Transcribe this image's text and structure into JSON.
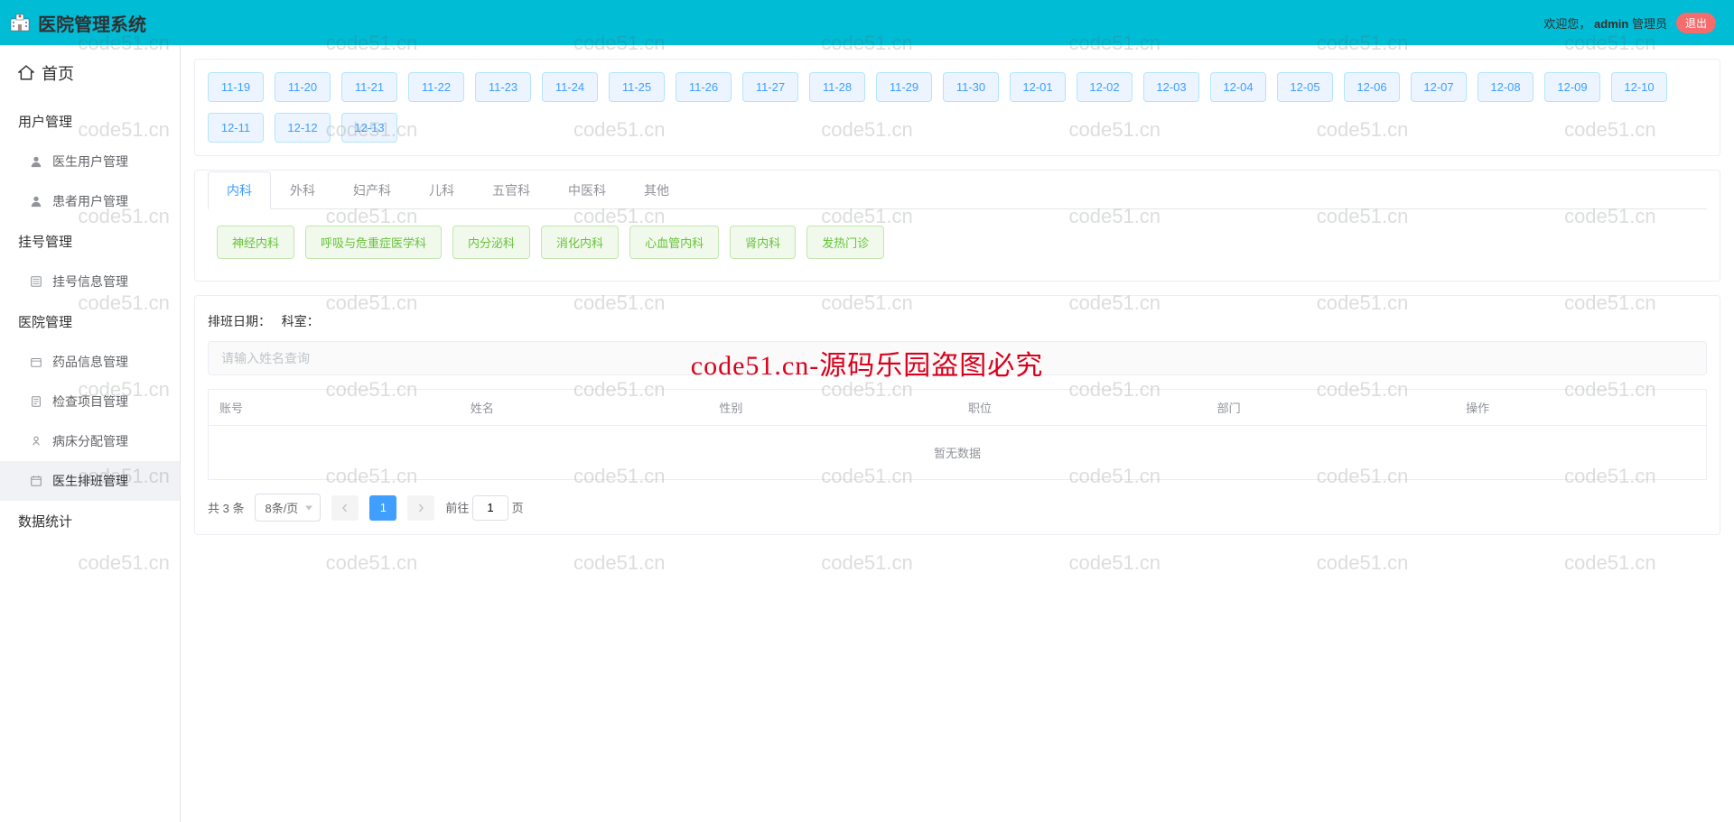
{
  "header": {
    "title": "医院管理系统",
    "welcome_prefix": "欢迎您，",
    "username": "admin",
    "role": "管理员",
    "logout": "退出"
  },
  "sidebar": {
    "home": "首页",
    "sections": [
      {
        "label": "用户管理",
        "items": [
          {
            "key": "doctor-user",
            "icon": "user-icon",
            "label": "医生用户管理"
          },
          {
            "key": "patient-user",
            "icon": "user-icon",
            "label": "患者用户管理"
          }
        ]
      },
      {
        "label": "挂号管理",
        "items": [
          {
            "key": "register-info",
            "icon": "list-icon",
            "label": "挂号信息管理"
          }
        ]
      },
      {
        "label": "医院管理",
        "items": [
          {
            "key": "drug-info",
            "icon": "box-icon",
            "label": "药品信息管理"
          },
          {
            "key": "check-item",
            "icon": "doc-icon",
            "label": "检查项目管理"
          },
          {
            "key": "bed-alloc",
            "icon": "bed-icon",
            "label": "病床分配管理"
          },
          {
            "key": "doctor-schedule",
            "icon": "calendar-icon",
            "label": "医生排班管理",
            "active": true
          }
        ]
      },
      {
        "label": "数据统计",
        "items": []
      }
    ]
  },
  "dates": [
    "11-19",
    "11-20",
    "11-21",
    "11-22",
    "11-23",
    "11-24",
    "11-25",
    "11-26",
    "11-27",
    "11-28",
    "11-29",
    "11-30",
    "12-01",
    "12-02",
    "12-03",
    "12-04",
    "12-05",
    "12-06",
    "12-07",
    "12-08",
    "12-09",
    "12-10",
    "12-11",
    "12-12",
    "12-13"
  ],
  "dept_tabs": [
    "内科",
    "外科",
    "妇产科",
    "儿科",
    "五官科",
    "中医科",
    "其他"
  ],
  "dept_tabs_active": 0,
  "sub_depts": [
    "神经内科",
    "呼吸与危重症医学科",
    "内分泌科",
    "消化内科",
    "心血管内科",
    "肾内科",
    "发热门诊"
  ],
  "filter": {
    "label_date": "排班日期：",
    "label_dept": "科室：",
    "search_placeholder": "请输入姓名查询"
  },
  "table": {
    "columns": [
      "账号",
      "姓名",
      "性别",
      "职位",
      "部门",
      "操作"
    ],
    "empty": "暂无数据"
  },
  "pagination": {
    "total_text": "共 3 条",
    "page_size": "8条/页",
    "current": "1",
    "goto_prefix": "前往",
    "goto_suffix": "页",
    "goto_value": "1"
  },
  "watermark": {
    "text": "code51.cn",
    "center": "code51.cn-源码乐园盗图必究"
  }
}
